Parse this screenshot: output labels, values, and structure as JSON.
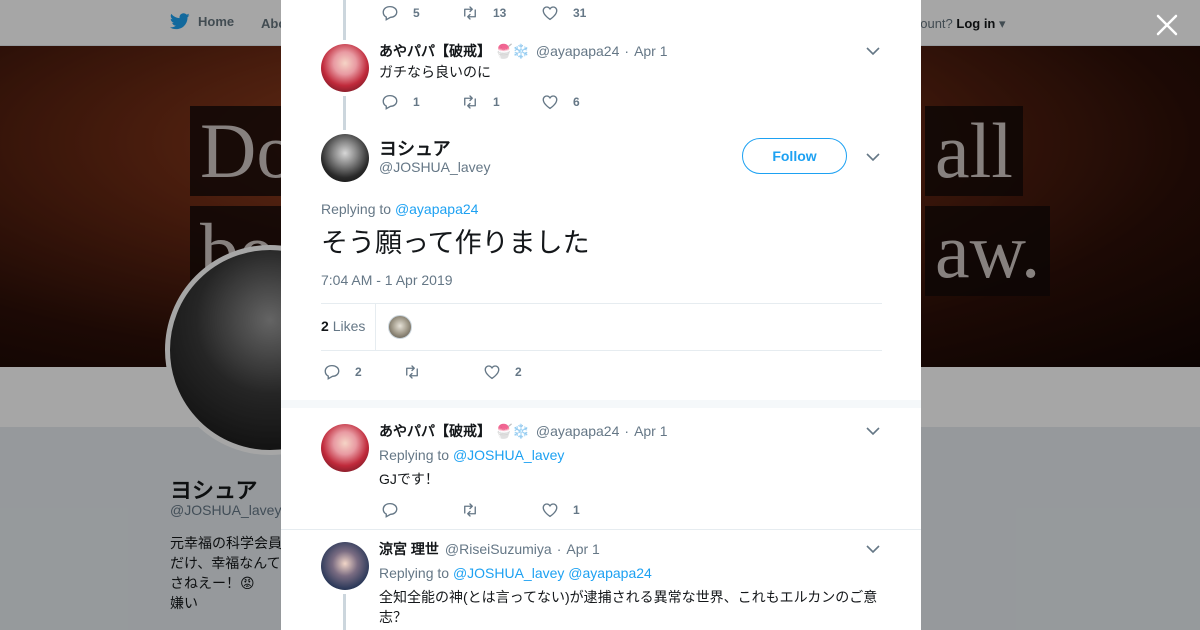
{
  "colors": {
    "brand": "#1da1f2",
    "text": "#14171a",
    "muted": "#657786",
    "like_red": "#e0245e"
  },
  "background": {
    "nav": {
      "home_label": "Home",
      "about_label": "Abo",
      "login_prompt": "account?",
      "login_label": "Log in"
    },
    "banner": {
      "line1_left": "Do",
      "line1_right": "all",
      "line2_left": "be",
      "line2_right": "aw."
    },
    "profile": {
      "name": "ヨシュア",
      "handle": "@JOSHUA_lavey",
      "bio_line1": "元幸福の科学会員",
      "bio_line2": "だけ、幸福なんて",
      "bio_line3": "さねえー！😡 ",
      "bio_line4": "嫌い"
    }
  },
  "modal": {
    "top_tweet_actions": {
      "replies": "5",
      "retweets": "13",
      "likes": "31"
    },
    "reply1": {
      "name": "あやパパ【破戒】",
      "emoji": "🍧❄️",
      "handle": "@ayapapa24",
      "time": "Apr 1",
      "text": "ガチなら良いのに",
      "replies": "1",
      "retweets": "1",
      "likes": "6"
    },
    "main": {
      "name": "ヨシュア",
      "handle": "@JOSHUA_lavey",
      "follow_label": "Follow",
      "replying_to_label": "Replying to",
      "replying_to": "@ayapapa24",
      "text": "そう願って作りました",
      "timestamp": "7:04 AM - 1 Apr 2019",
      "likes_count": "2",
      "likes_label": "Likes",
      "replies": "2",
      "retweets": "",
      "likes": "2"
    },
    "reply2": {
      "name": "あやパパ【破戒】",
      "emoji": "🍧❄️",
      "handle": "@ayapapa24",
      "time": "Apr 1",
      "replying_to_label": "Replying to",
      "replying_to": "@JOSHUA_lavey",
      "text": "GJです！",
      "replies": "",
      "retweets": "",
      "likes": "1"
    },
    "reply3": {
      "name": "涼宮 理世",
      "handle": "@RiseiSuzumiya",
      "time": "Apr 1",
      "replying_to_label": "Replying to",
      "replying_to_1": "@JOSHUA_lavey",
      "replying_to_2": "@ayapapa24",
      "text": "全知全能の神(とは言ってない)が逮捕される異常な世界、これもエルカンのご意志？"
    }
  }
}
